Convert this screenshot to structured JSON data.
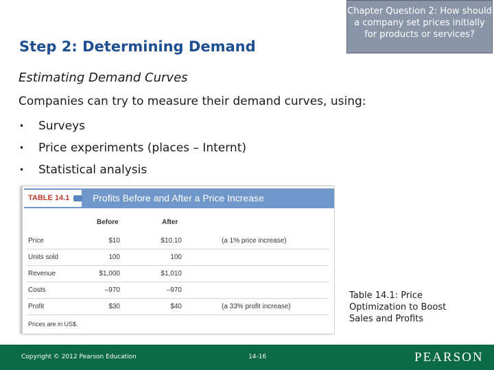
{
  "slide": {
    "title": "Step 2: Determining Demand",
    "chapter_question": "Chapter Question 2: How should a company set prices initially for products or services?",
    "subtitle": "Estimating Demand Curves",
    "intro": "Companies can try to measure their demand curves, using:",
    "bullets": [
      "Surveys",
      "Price experiments (places – Internt)",
      "Statistical analysis"
    ],
    "bullet_glyph": "•"
  },
  "table": {
    "tag": "TABLE 14.1",
    "title": "Profits Before and After a Price Increase",
    "columns": [
      "",
      "Before",
      "After",
      ""
    ],
    "rows": [
      [
        "Price",
        "$10",
        "$10.10",
        "(a 1% price increase)"
      ],
      [
        "Units sold",
        "100",
        "100",
        ""
      ],
      [
        "Revenue",
        "$1,000",
        "$1,010",
        ""
      ],
      [
        "Costs",
        "–970",
        "–970",
        ""
      ],
      [
        "Profit",
        "$30",
        "$40",
        "(a 33% profit increase)"
      ]
    ],
    "note": "Prices are in US$."
  },
  "caption": "Table 14.1: Price Optimization to Boost Sales and Profits",
  "footer": {
    "copyright": "Copyright © 2012 Pearson Education",
    "page": "14-16",
    "logo": "PEARSON"
  },
  "colors": {
    "title": "#1d4e8f",
    "footer": "#0c6a45",
    "chapter_box": "#8b95a8",
    "table_header": "#6f97c9",
    "table_tag": "#c0392b"
  }
}
